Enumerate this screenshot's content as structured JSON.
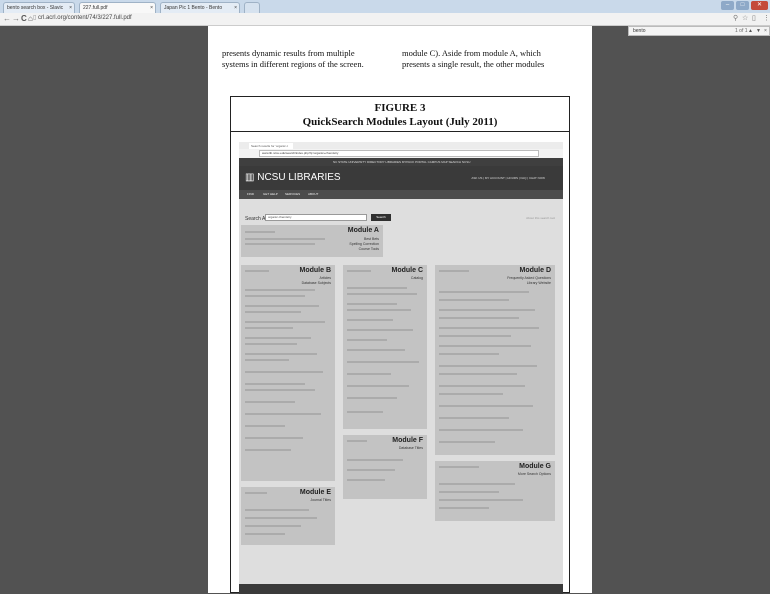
{
  "browser": {
    "tabs": [
      {
        "label": "bento search box - Slavic",
        "active": false
      },
      {
        "label": "227.full.pdf",
        "active": true
      },
      {
        "label": "Japan Pic 1 Bento - Bento",
        "active": false
      }
    ],
    "url": "crl.acrl.org/content/74/3/227.full.pdf",
    "find": {
      "query": "bento",
      "count": "1 of 1"
    }
  },
  "paper": {
    "left_col": [
      "presents dynamic results from multiple",
      "systems in different regions of the screen."
    ],
    "right_col": [
      "module C). Aside from module A, which",
      "presents a single result, the other modules"
    ]
  },
  "figure": {
    "number": "FIGURE 3",
    "title": "QuickSearch Modules Layout (July 2011)",
    "screenshot": {
      "tab": "Search results for 'organic c",
      "url": "www.lib.ncsu.edu/search/index.php?q=organic+chemistry",
      "utility": "NC STATE UNIVERSITY  DIRECTORY  LIBRARIES  MYPACK PORTAL  CAMPUS MAP  SEARCH NCSU",
      "logo": "NCSU LIBRARIES",
      "header_links": "ASK US  |  MY ACCOUNT  |  HOURS  |  FAQ  |  CHAT NOW",
      "nav": [
        "FIND",
        "GET HELP",
        "SERVICES",
        "ABOUT"
      ],
      "search_label": "Search All",
      "search_value": "organic chemistry",
      "search_button": "Search",
      "right_note": "About this search tool",
      "modules": [
        {
          "title": "Module A",
          "sub": [
            "Best Bets",
            "Spelling Correction",
            "Course Tools"
          ]
        },
        {
          "title": "Module B",
          "sub": [
            "Articles",
            "Database Subjects"
          ]
        },
        {
          "title": "Module C",
          "sub": [
            "Catalog"
          ]
        },
        {
          "title": "Module D",
          "sub": [
            "Frequently Asked Questions",
            "Library Website"
          ]
        },
        {
          "title": "Module E",
          "sub": [
            "Journal Titles"
          ]
        },
        {
          "title": "Module F",
          "sub": [
            "Database Titles"
          ]
        },
        {
          "title": "Module G",
          "sub": [
            "More Search Options"
          ]
        }
      ]
    }
  },
  "colors": {
    "viewer_bg": "#525252",
    "page_bg": "#ffffff",
    "module_bg": "#c3c3c3"
  }
}
